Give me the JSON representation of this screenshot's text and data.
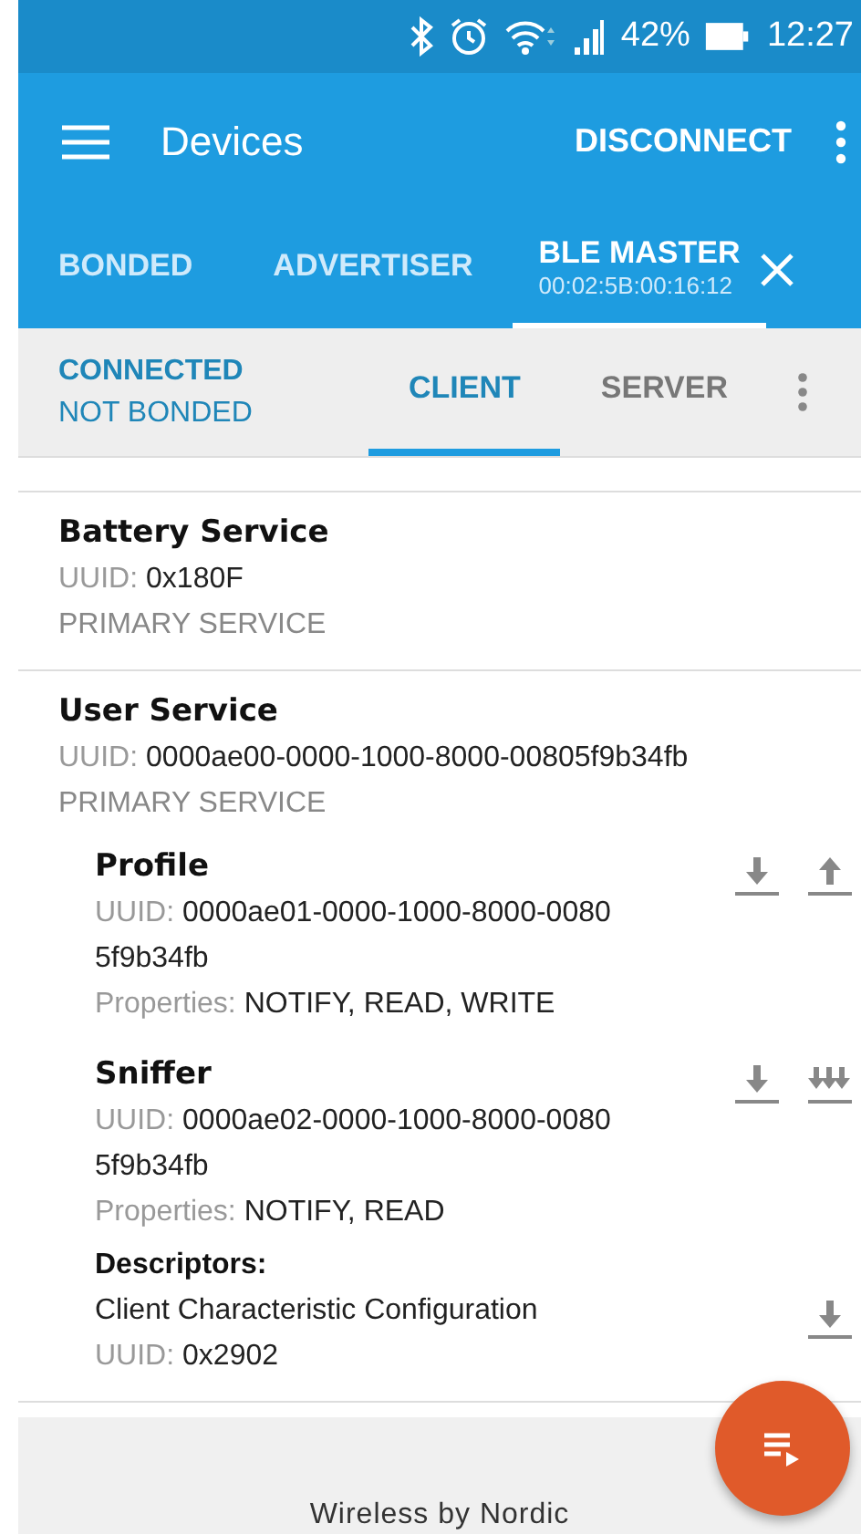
{
  "status_bar": {
    "battery": "42%",
    "time": "12:27"
  },
  "toolbar": {
    "title": "Devices",
    "action": "DISCONNECT"
  },
  "tabs": [
    {
      "label": "BONDED",
      "selected": false
    },
    {
      "label": "ADVERTISER",
      "selected": false
    },
    {
      "label": "BLE MASTER",
      "sublabel": "00:02:5B:00:16:12",
      "selected": true
    }
  ],
  "connection": {
    "status": "CONNECTED",
    "bond": "NOT BONDED",
    "tabs": [
      {
        "label": "CLIENT",
        "selected": true
      },
      {
        "label": "SERVER",
        "selected": false
      }
    ]
  },
  "services": [
    {
      "name": "Battery Service",
      "uuid_label": "UUID:",
      "uuid": [
        "0x180F"
      ],
      "type": "PRIMARY SERVICE"
    },
    {
      "name": "User Service",
      "uuid_label": "UUID:",
      "uuid": [
        "0000ae00-0000-1000-8000-00805f9b34fb"
      ],
      "type": "PRIMARY SERVICE",
      "characteristics": [
        {
          "name": "Profile",
          "uuid_label": "UUID:",
          "uuid": [
            "0000ae01-0000-1000-8000-0080",
            "5f9b34fb"
          ],
          "properties_label": "Properties:",
          "properties": "NOTIFY, READ, WRITE",
          "actions": [
            {
              "kind": "read"
            },
            {
              "kind": "write"
            }
          ]
        },
        {
          "name": "Sniffer",
          "uuid_label": "UUID:",
          "uuid": [
            "0000ae02-0000-1000-8000-0080",
            "5f9b34fb"
          ],
          "properties_label": "Properties:",
          "properties": "NOTIFY, READ",
          "actions": [
            {
              "kind": "read"
            },
            {
              "kind": "notify"
            }
          ],
          "descriptors_title": "Descriptors:",
          "descriptors": [
            {
              "name": "Client Characteristic Configuration",
              "uuid_label": "UUID:",
              "uuid": "0x2902",
              "actions": [
                {
                  "kind": "read"
                }
              ]
            }
          ]
        }
      ]
    }
  ],
  "footer": "Wireless by Nordic"
}
